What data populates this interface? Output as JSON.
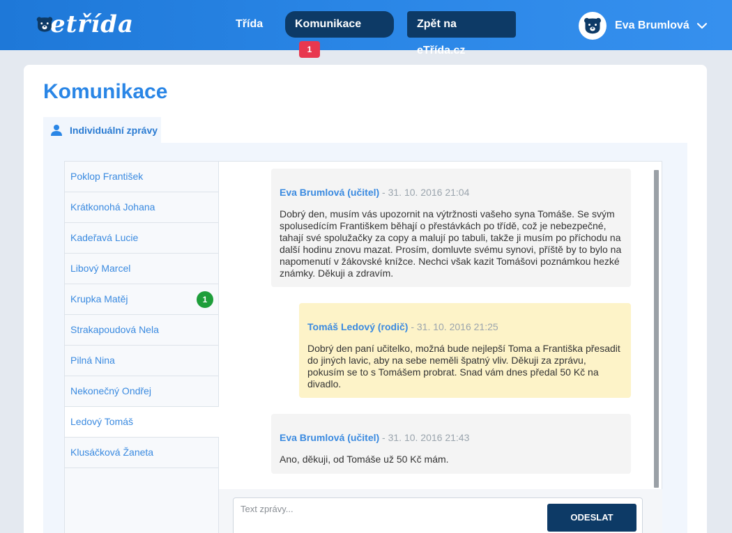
{
  "header": {
    "logo_text": "etřída",
    "nav": {
      "trida": "Třída",
      "komunikace": "Komunikace",
      "komunikace_badge": "1",
      "zpet": "Zpět na eTřída.cz"
    },
    "user": {
      "name": "Eva Brumlová"
    }
  },
  "page": {
    "title": "Komunikace"
  },
  "tabs": [
    {
      "label": "Individuální zprávy"
    }
  ],
  "contacts": [
    {
      "name": "Poklop František"
    },
    {
      "name": "Krátkonohá Johana"
    },
    {
      "name": "Kadeřavá Lucie"
    },
    {
      "name": "Libový Marcel"
    },
    {
      "name": "Krupka Matěj",
      "badge": "1"
    },
    {
      "name": "Strakapoudová Nela"
    },
    {
      "name": "Pilná Nina"
    },
    {
      "name": "Nekonečný Ondřej"
    },
    {
      "name": "Ledový Tomáš",
      "active": true
    },
    {
      "name": "Klusáčková Žaneta"
    }
  ],
  "messages": [
    {
      "author": "Eva Brumlová (učitel)",
      "date": " - 31. 10. 2016 21:04",
      "text": "Dobrý den, musím vás upozornit na výtržnosti vašeho syna Tomáše. Se svým spolusedícím Františkem běhají o přestávkách po třídě, což je nebezpečné, tahají své spolužačky za copy a malují po tabuli, takže ji musím po příchodu na další hodinu znovu mazat. Prosím, domluvte svému synovi, příště by to bylo na napomenutí v žákovské knížce. Nechci však kazit Tomášovi poznámkou hezké známky. Děkuji a zdravím."
    },
    {
      "author": "Tomáš Ledový (rodič)",
      "date": " - 31. 10. 2016 21:25",
      "text": "Dobrý den paní učitelko, možná bude nejlepší Toma a Františka přesadit do jiných lavic, aby na sebe neměli špatný vliv. Děkuji za zprávu, pokusím se to s Tomášem probrat. Snad vám dnes předal 50 Kč na divadlo."
    },
    {
      "author": "Eva Brumlová (učitel)",
      "date": " - 31. 10. 2016 21:43",
      "text": "Ano, děkuji, od Tomáše už 50 Kč mám."
    }
  ],
  "composer": {
    "placeholder": "Text zprávy...",
    "send_label": "ODESLAT"
  },
  "colors": {
    "brand_blue": "#2a86e6",
    "dark_navy": "#0d3a66",
    "badge_red": "#e8384f",
    "badge_green": "#1e9e3a",
    "parent_bubble": "#fdf3c8",
    "teacher_bubble": "#f4f4f4"
  }
}
